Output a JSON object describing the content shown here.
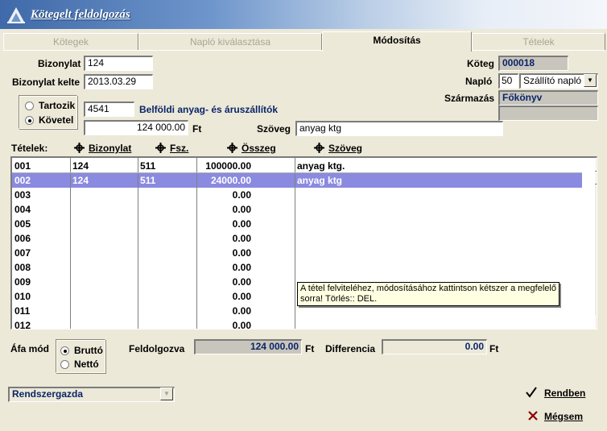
{
  "window": {
    "title": "Kötegelt feldolgozás"
  },
  "tabs": [
    {
      "label": "Kötegek",
      "active": false
    },
    {
      "label": "Napló kiválasztása",
      "active": false
    },
    {
      "label": "Módosítás",
      "active": true
    },
    {
      "label": "Tételek",
      "active": false
    }
  ],
  "header": {
    "bizonylat_label": "Bizonylat",
    "bizonylat_value": "124",
    "kelte_label": "Bizonylat kelte",
    "kelte_value": "2013.03.29",
    "koteg_label": "Köteg",
    "koteg_value": "000018",
    "naplo_label": "Napló",
    "naplo_num": "50",
    "naplo_name": "Szállító napló",
    "szarmazas_label": "Származás",
    "szarmazas_value": "Főkönyv",
    "szarmazas_extra": ""
  },
  "booking": {
    "tartozik_label": "Tartozik",
    "kovetel_label": "Követel",
    "selected": "Követel",
    "account_value": "4541",
    "account_name": "Belföldi anyag- és áruszállítók",
    "amount_value": "124 000.00",
    "amount_unit": "Ft",
    "szoveg_label": "Szöveg",
    "szoveg_value": "anyag ktg"
  },
  "grid": {
    "label": "Tételek:",
    "columns": [
      "Bizonylat",
      "Fsz.",
      "Összeg",
      "Szöveg"
    ],
    "rows": [
      {
        "id": "001",
        "bizonylat": "124",
        "fsz": "511",
        "osszeg": "100000.00",
        "szoveg": "anyag ktg."
      },
      {
        "id": "002",
        "bizonylat": "124",
        "fsz": "511",
        "osszeg": "24000.00",
        "szoveg": "anyag ktg"
      },
      {
        "id": "003",
        "bizonylat": "",
        "fsz": "",
        "osszeg": "0.00",
        "szoveg": ""
      },
      {
        "id": "004",
        "bizonylat": "",
        "fsz": "",
        "osszeg": "0.00",
        "szoveg": ""
      },
      {
        "id": "005",
        "bizonylat": "",
        "fsz": "",
        "osszeg": "0.00",
        "szoveg": ""
      },
      {
        "id": "006",
        "bizonylat": "",
        "fsz": "",
        "osszeg": "0.00",
        "szoveg": ""
      },
      {
        "id": "007",
        "bizonylat": "",
        "fsz": "",
        "osszeg": "0.00",
        "szoveg": ""
      },
      {
        "id": "008",
        "bizonylat": "",
        "fsz": "",
        "osszeg": "0.00",
        "szoveg": ""
      },
      {
        "id": "009",
        "bizonylat": "",
        "fsz": "",
        "osszeg": "0.00",
        "szoveg": ""
      },
      {
        "id": "010",
        "bizonylat": "",
        "fsz": "",
        "osszeg": "0.00",
        "szoveg": ""
      },
      {
        "id": "011",
        "bizonylat": "",
        "fsz": "",
        "osszeg": "0.00",
        "szoveg": ""
      },
      {
        "id": "012",
        "bizonylat": "",
        "fsz": "",
        "osszeg": "0.00",
        "szoveg": ""
      }
    ],
    "selected_row": 1,
    "tooltip": "A tétel felviteléhez, módosításához kattintson kétszer a megfelelő sorra! Törlés:: DEL."
  },
  "footer": {
    "afa_label": "Áfa mód",
    "brutto_label": "Bruttó",
    "netto_label": "Nettó",
    "afa_selected": "Bruttó",
    "feldolgozva_label": "Feldolgozva",
    "feldolgozva_value": "124 000.00",
    "feldolgozva_unit": "Ft",
    "differencia_label": "Differencia",
    "differencia_value": "0.00",
    "differencia_unit": "Ft",
    "user_value": "Rendszergazda",
    "ok_label": "Rendben",
    "cancel_label": "Mégsem"
  },
  "colors": {
    "accent_blue": "#0a246a",
    "selection": "#8a8ae0",
    "ok_icon": "#000000",
    "cancel_icon": "#8b0000"
  }
}
